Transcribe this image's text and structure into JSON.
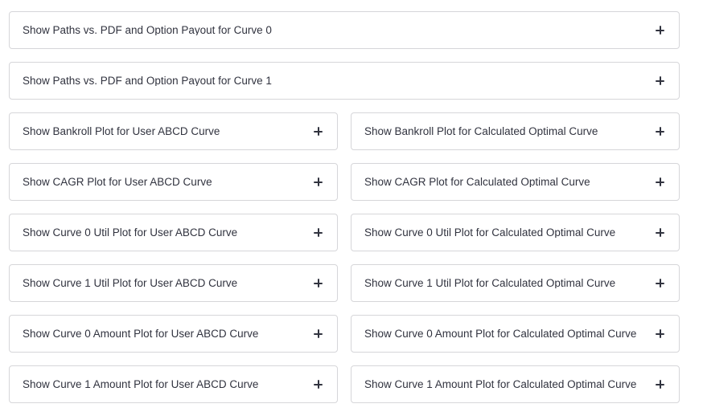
{
  "expanders": {
    "paths_curve_0": "Show Paths vs. PDF and Option Payout for Curve 0",
    "paths_curve_1": "Show Paths vs. PDF and Option Payout for Curve 1",
    "bankroll_user": "Show Bankroll Plot for User ABCD Curve",
    "bankroll_optimal": "Show Bankroll Plot for Calculated Optimal Curve",
    "cagr_user": "Show CAGR Plot for User ABCD Curve",
    "cagr_optimal": "Show CAGR Plot for Calculated Optimal Curve",
    "curve0_util_user": "Show Curve 0 Util Plot for User ABCD Curve",
    "curve0_util_optimal": "Show Curve 0 Util Plot for Calculated Optimal Curve",
    "curve1_util_user": "Show Curve 1 Util Plot for User ABCD Curve",
    "curve1_util_optimal": "Show Curve 1 Util Plot for Calculated Optimal Curve",
    "curve0_amount_user": "Show Curve 0 Amount Plot for User ABCD Curve",
    "curve0_amount_optimal": "Show Curve 0 Amount Plot for Calculated Optimal Curve",
    "curve1_amount_user": "Show Curve 1 Amount Plot for User ABCD Curve",
    "curve1_amount_optimal": "Show Curve 1 Amount Plot for Calculated Optimal Curve"
  },
  "icons": {
    "expand": "plus-icon"
  },
  "colors": {
    "text": "#31333f",
    "border": "#d6d6d9",
    "background": "#ffffff"
  }
}
